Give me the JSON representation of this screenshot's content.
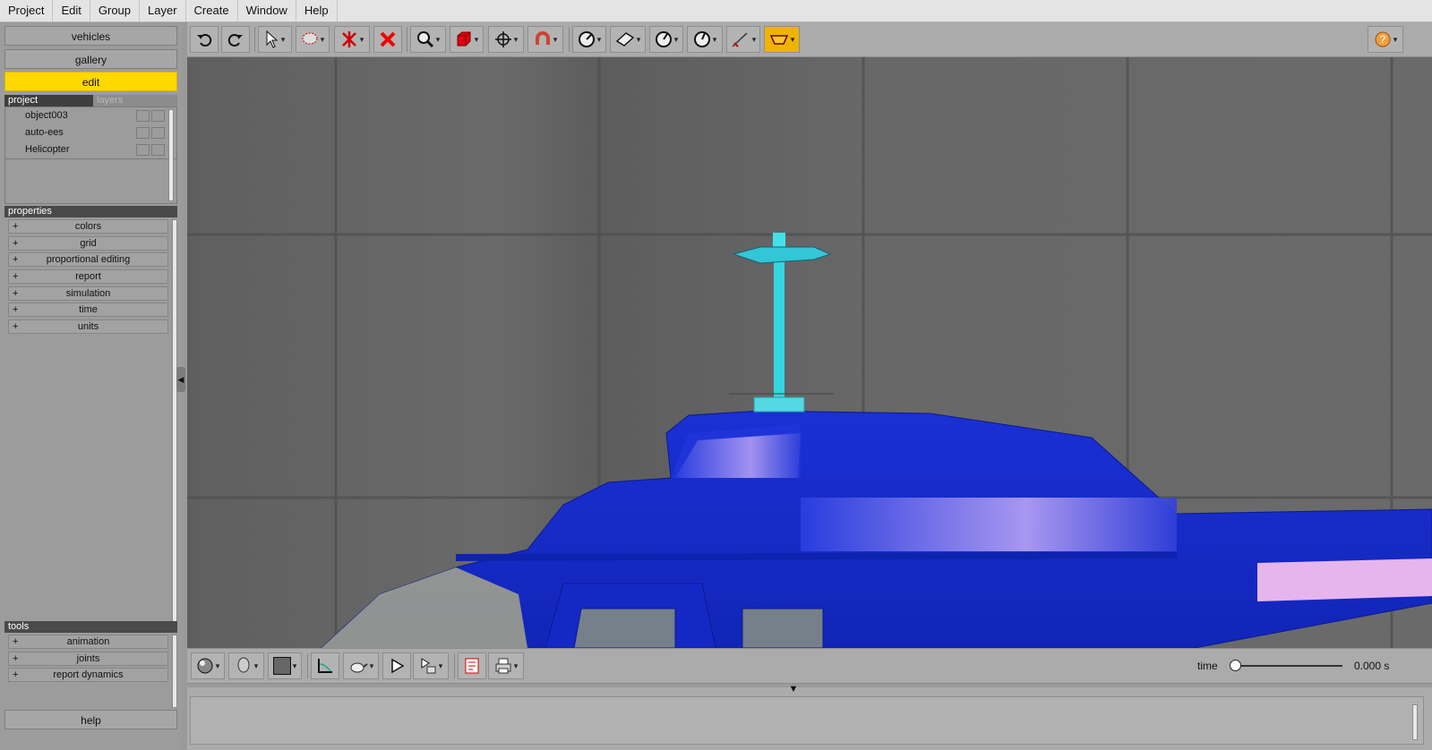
{
  "menu": [
    "Project",
    "Edit",
    "Group",
    "Layer",
    "Create",
    "Window",
    "Help"
  ],
  "nav": {
    "vehicles": "vehicles",
    "gallery": "gallery",
    "edit": "edit",
    "help": "help"
  },
  "project_tabs": {
    "project": "project",
    "layers": "layers"
  },
  "objects": [
    "object003",
    "auto-ees",
    "Helicopter"
  ],
  "properties": {
    "header": "properties",
    "items": [
      "colors",
      "grid",
      "proportional editing",
      "report",
      "simulation",
      "time",
      "units"
    ]
  },
  "tools": {
    "header": "tools",
    "items": [
      "animation",
      "joints",
      "report dynamics"
    ]
  },
  "expand_symbol": "+",
  "timeline": {
    "label": "time",
    "value": "0.000 s",
    "position": 0
  },
  "colors": {
    "accent": "#ffd800",
    "helicopter_body": "#1a2fd0",
    "rotor": "#33d6e0"
  },
  "toolbar_icons": [
    "undo-icon",
    "redo-icon",
    "select-icon",
    "lasso-icon",
    "explode-icon",
    "delete-icon",
    "zoom-icon",
    "cube-icon",
    "move-icon",
    "magnet-icon",
    "measure-icon",
    "plane-icon",
    "gauge-icon",
    "gauge2-icon",
    "ruler-icon",
    "auto-icon",
    "help-icon"
  ]
}
